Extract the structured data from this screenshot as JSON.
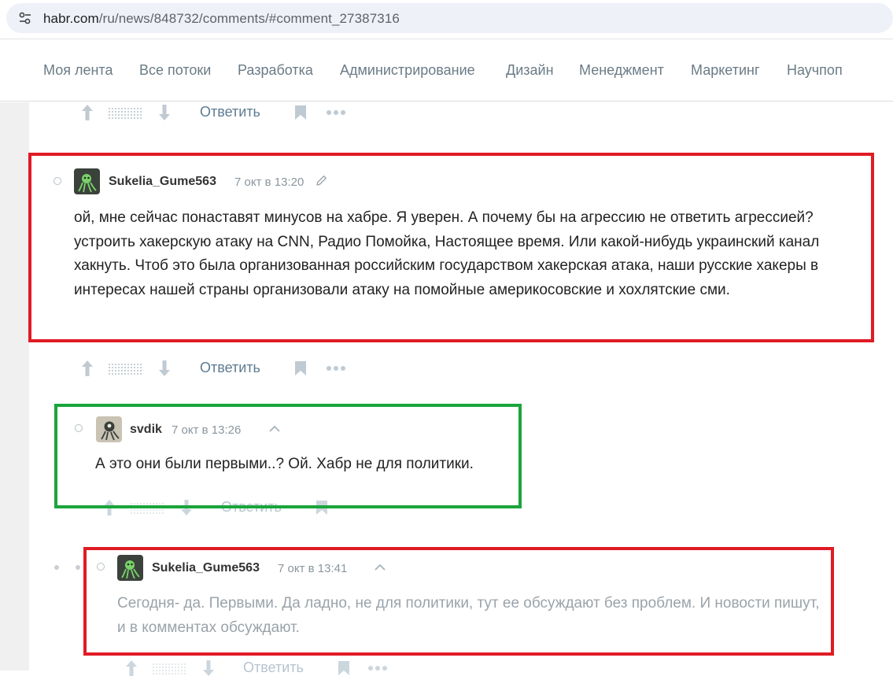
{
  "browser": {
    "url_host": "habr.com",
    "url_path": "/ru/news/848732/comments/#comment_27387316"
  },
  "nav": {
    "items": [
      "Моя лента",
      "Все потоки",
      "Разработка",
      "Администрирование",
      "Дизайн",
      "Менеджмент",
      "Маркетинг",
      "Научпоп"
    ]
  },
  "actions": {
    "reply_label": "Ответить"
  },
  "comments": [
    {
      "user": "Sukelia_Gume563",
      "time": "7 окт в 13:20",
      "text": "ой, мне сейчас понаставят минусов на хабре. Я уверен. А почему бы на агрессию не ответить агрессией? устроить хакерскую атаку на CNN, Радио Помойка, Настоящее время. Или какой-нибудь украинский канал хакнуть. Чтоб это была организованная российским государством хакерская атака, наши русские хакеры в интересах нашей страны организовали атаку на помойные америкосовские и хохлятские сми."
    },
    {
      "user": "svdik",
      "time": "7 окт в 13:26",
      "text": "А это они были первыми..? Ой. Хабр не для политики."
    },
    {
      "user": "Sukelia_Gume563",
      "time": "7 окт в 13:41",
      "text": "Сегодня- да. Первыми. Да ладно, не для политики, тут ее обсуждают без проблем. И новости пишут, и в комментах обсуждают."
    }
  ],
  "icons": {
    "url_settings": "tune-icon",
    "edit": "pencil-icon",
    "collapse": "chevron-up-icon",
    "upvote": "arrow-up-icon",
    "downvote": "arrow-down-icon",
    "bookmark": "bookmark-icon",
    "more": "more-dots-icon"
  },
  "colors": {
    "highlight_red": "#e01b24",
    "highlight_green": "#1aa53b",
    "nav_text": "#6b7b86",
    "reply_link": "#5e7b91"
  }
}
